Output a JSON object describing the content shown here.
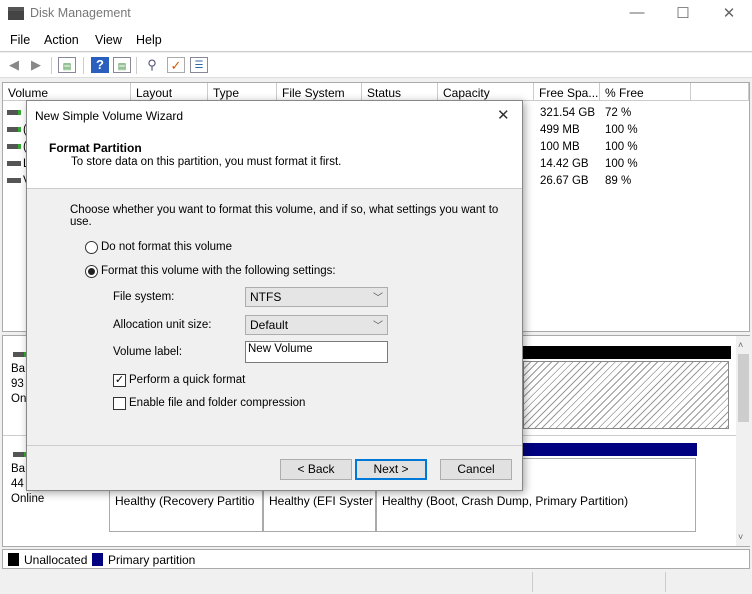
{
  "window": {
    "title": "Disk Management",
    "minimize": "—",
    "maximize": "☐",
    "close": "✕"
  },
  "menu": [
    "File",
    "Action",
    "View",
    "Help"
  ],
  "toolbar": {
    "icons": [
      "back-arrow-icon",
      "forward-arrow-icon",
      "console-tree-icon",
      "help-icon",
      "action-pane-icon",
      "connect-icon",
      "properties-icon",
      "settings-list-icon"
    ]
  },
  "list": {
    "columns": [
      "Volume",
      "Layout",
      "Type",
      "File System",
      "Status",
      "Capacity",
      "Free Spa...",
      "% Free"
    ],
    "rows": [
      {
        "volume_fragment": "",
        "free": "321.54 GB",
        "pct": "72 %"
      },
      {
        "volume_fragment": "(",
        "free": "499 MB",
        "pct": "100 %"
      },
      {
        "volume_fragment": "(",
        "free": "100 MB",
        "pct": "100 %"
      },
      {
        "volume_fragment": "L",
        "free": "14.42 GB",
        "pct": "100 %"
      },
      {
        "volume_fragment": "V",
        "free": "26.67 GB",
        "pct": "89 %"
      }
    ]
  },
  "disks": [
    {
      "lines": [
        "Ba",
        "93",
        "On"
      ]
    },
    {
      "lines": [
        "Ba",
        "44",
        "Online"
      ],
      "partitions": [
        "Healthy (Recovery Partitio",
        "Healthy (EFI Syster",
        "Healthy (Boot, Crash Dump, Primary Partition)"
      ]
    }
  ],
  "legend": [
    {
      "label": "Unallocated",
      "color": "#000000"
    },
    {
      "label": "Primary partition",
      "color": "#000080"
    }
  ],
  "dialog": {
    "title": "New Simple Volume Wizard",
    "heading": "Format Partition",
    "subheading": "To store data on this partition, you must format it first.",
    "instruction": "Choose whether you want to format this volume, and if so, what settings you want to use.",
    "radio_no_format": "Do not format this volume",
    "radio_format": "Format this volume with the following settings:",
    "selected_radio": "format",
    "file_system_label": "File system:",
    "file_system_value": "NTFS",
    "alloc_label": "Allocation unit size:",
    "alloc_value": "Default",
    "volume_label_label": "Volume label:",
    "volume_label_value": "New Volume",
    "quick_format_label": "Perform a quick format",
    "quick_format_checked": true,
    "compression_label": "Enable file and folder compression",
    "compression_checked": false,
    "back": "< Back",
    "next": "Next >",
    "cancel": "Cancel",
    "close": "✕"
  }
}
